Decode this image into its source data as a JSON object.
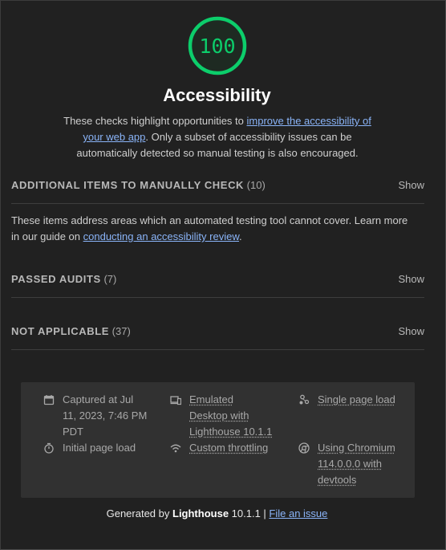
{
  "score": {
    "value": "100",
    "fraction": 1.0,
    "color": "#0cce6b"
  },
  "category": {
    "title": "Accessibility",
    "desc_before": "These checks highlight opportunities to ",
    "desc_link": "improve the accessibility of your web app",
    "desc_after": ". Only a subset of accessibility issues can be automatically detected so manual testing is also encouraged."
  },
  "sections": [
    {
      "title": "ADDITIONAL ITEMS TO MANUALLY CHECK",
      "count": "(10)",
      "toggle": "Show"
    },
    {
      "title": "PASSED AUDITS",
      "count": "(7)",
      "toggle": "Show"
    },
    {
      "title": "NOT APPLICABLE",
      "count": "(37)",
      "toggle": "Show"
    }
  ],
  "manual_desc": {
    "before": "These items address areas which an automated testing tool cannot cover. Learn more in our guide on ",
    "link": "conducting an accessibility review",
    "after": "."
  },
  "meta": {
    "captured": "Captured at Jul 11, 2023, 7:46 PM PDT",
    "emulated": "Emulated Desktop with Lighthouse 10.1.1",
    "single_page": "Single page load",
    "initial_load": "Initial page load",
    "throttling": "Custom throttling",
    "chromium": "Using Chromium 114.0.0.0 with devtools"
  },
  "footer": {
    "generated_by": "Generated by ",
    "brand": "Lighthouse",
    "version": " 10.1.1 | ",
    "issue_link": "File an issue"
  }
}
